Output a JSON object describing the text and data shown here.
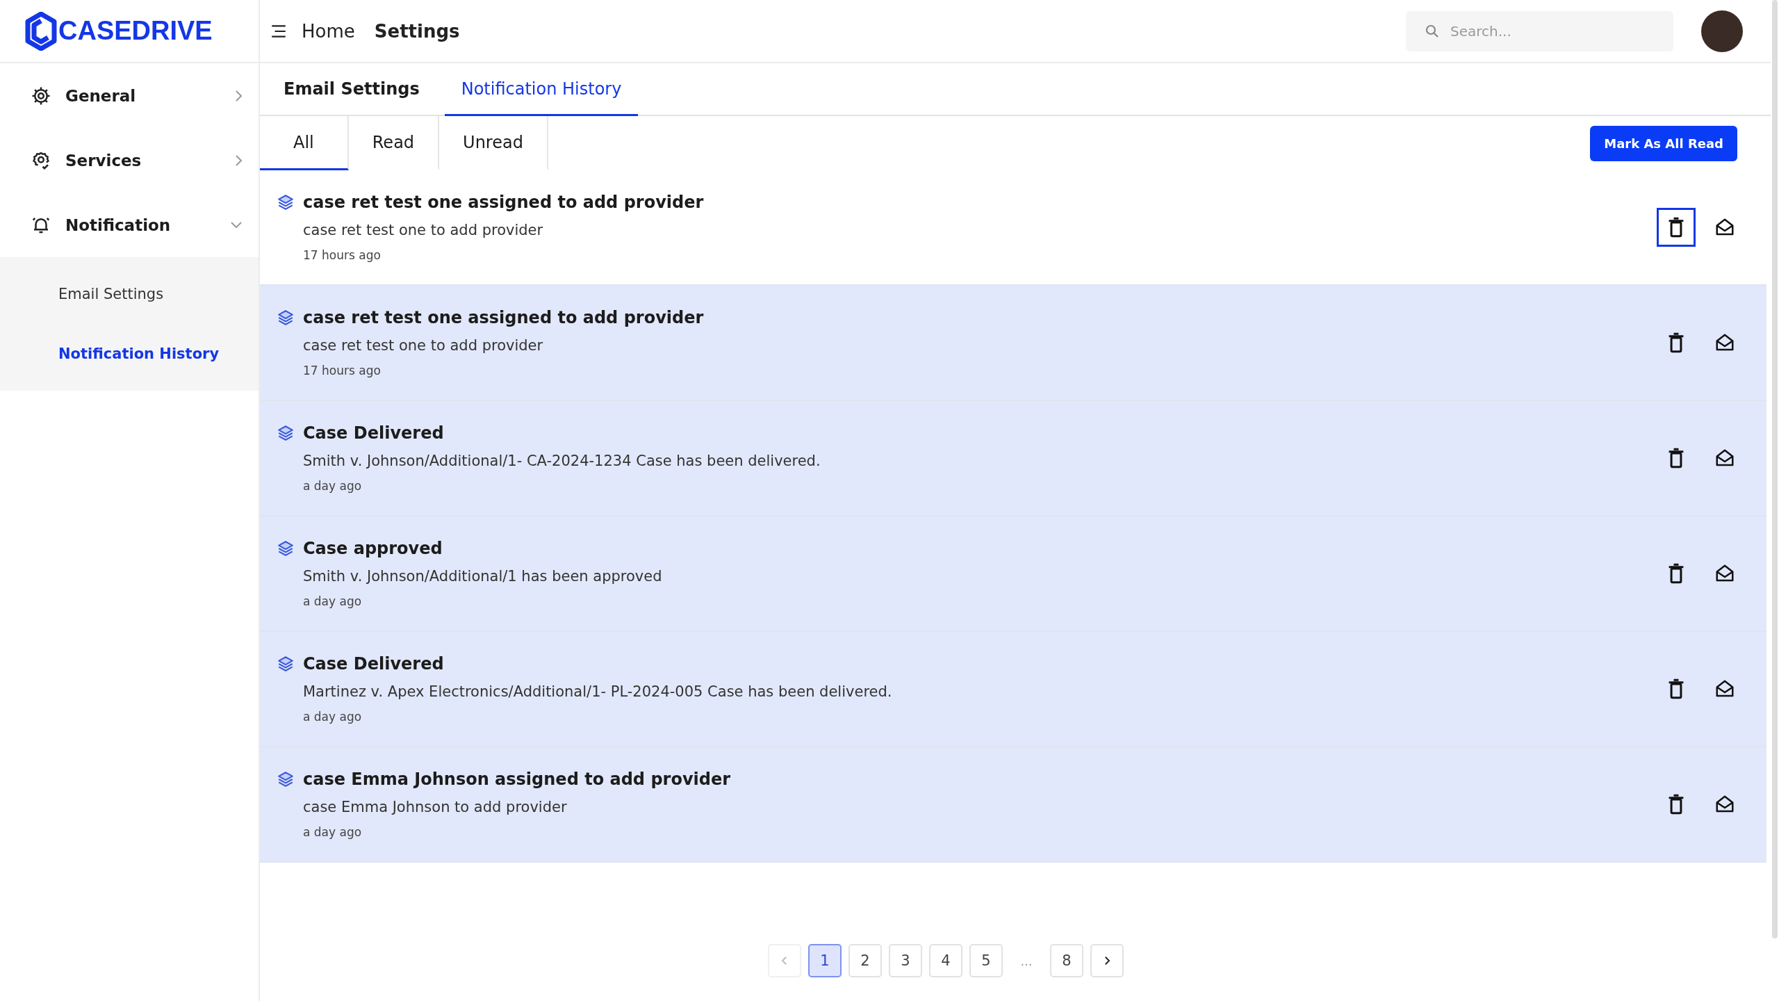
{
  "logo": {
    "text": "CASEDRIVE"
  },
  "sidebar": {
    "items": [
      {
        "label": "General",
        "expanded": false
      },
      {
        "label": "Services",
        "expanded": false
      },
      {
        "label": "Notification",
        "expanded": true,
        "children": [
          {
            "label": "Email Settings",
            "selected": false
          },
          {
            "label": "Notification History",
            "selected": true
          }
        ]
      }
    ]
  },
  "header": {
    "breadcrumb": [
      "Home",
      "Settings"
    ],
    "search": {
      "placeholder": "Search..."
    }
  },
  "tabs": [
    {
      "label": "Email Settings",
      "selected": false
    },
    {
      "label": "Notification History",
      "selected": true
    }
  ],
  "filters": [
    {
      "label": "All",
      "selected": true
    },
    {
      "label": "Read",
      "selected": false
    },
    {
      "label": "Unread",
      "selected": false
    }
  ],
  "mark_all_button": "Mark As All Read",
  "notifications": [
    {
      "title": "case ret test one assigned to add provider",
      "message": "case ret test one to add provider",
      "time": "17 hours ago",
      "read": true,
      "delete_focused": true
    },
    {
      "title": "case ret test one assigned to add provider",
      "message": "case ret test one to add provider",
      "time": "17 hours ago",
      "read": false,
      "delete_focused": false
    },
    {
      "title": "Case Delivered",
      "message": "Smith v. Johnson/Additional/1- CA-2024-1234 Case has been delivered.",
      "time": "a day ago",
      "read": false,
      "delete_focused": false
    },
    {
      "title": "Case approved",
      "message": "Smith v. Johnson/Additional/1 has been approved",
      "time": "a day ago",
      "read": false,
      "delete_focused": false
    },
    {
      "title": "Case Delivered",
      "message": "Martinez v. Apex Electronics/Additional/1- PL-2024-005 Case has been delivered.",
      "time": "a day ago",
      "read": false,
      "delete_focused": false
    },
    {
      "title": "case Emma Johnson assigned to add provider",
      "message": "case Emma Johnson to add provider",
      "time": "a day ago",
      "read": false,
      "delete_focused": false
    }
  ],
  "pagination": {
    "pages": [
      {
        "label": "1",
        "selected": true
      },
      {
        "label": "2",
        "selected": false
      },
      {
        "label": "3",
        "selected": false
      },
      {
        "label": "4",
        "selected": false
      },
      {
        "label": "5",
        "selected": false
      },
      {
        "label": "...",
        "kind": "gap"
      },
      {
        "label": "8",
        "selected": false
      }
    ],
    "prev_disabled": true,
    "next_disabled": false
  }
}
